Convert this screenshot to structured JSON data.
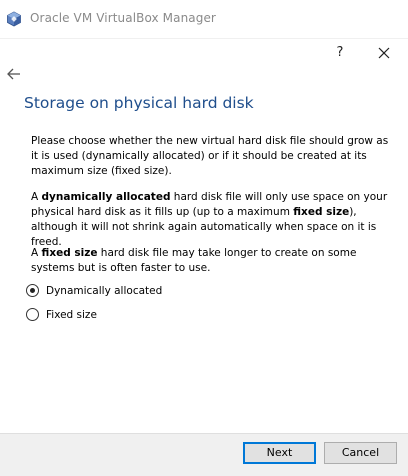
{
  "window": {
    "title": "Oracle VM VirtualBox Manager"
  },
  "dialog": {
    "help_label": "?",
    "heading": "Storage on physical hard disk",
    "paragraph1": "Please choose whether the new virtual hard disk file should grow as it is used (dynamically allocated) or if it should be created at its maximum size (fixed size).",
    "paragraph2": {
      "t1": "A ",
      "b1": "dynamically allocated",
      "t2": " hard disk file will only use space on your physical hard disk as it fills up (up to a maximum ",
      "b2": "fixed size",
      "t3": "), although it will not shrink again automatically when space on it is freed."
    },
    "paragraph3": {
      "t1": "A ",
      "b1": "fixed size",
      "t2": " hard disk file may take longer to create on some systems but is often faster to use."
    },
    "options": [
      {
        "label": "Dynamically allocated",
        "selected": true
      },
      {
        "label": "Fixed size",
        "selected": false
      }
    ]
  },
  "buttons": {
    "next": "Next",
    "cancel": "Cancel"
  },
  "icons": {
    "app": "virtualbox-cube-icon",
    "help": "help-icon",
    "close": "close-icon",
    "back": "back-arrow-icon"
  },
  "colors": {
    "heading": "#1f4e8c",
    "default_button_border": "#0078d7"
  }
}
